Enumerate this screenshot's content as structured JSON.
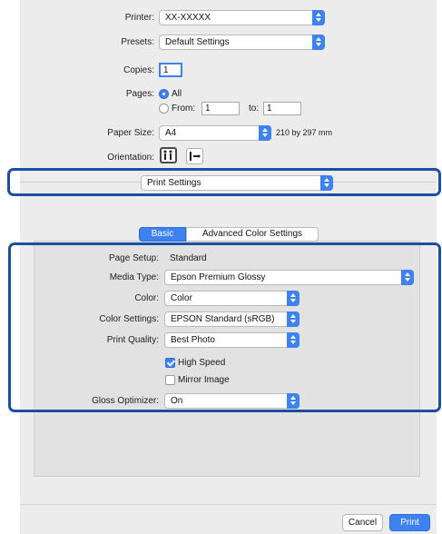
{
  "header": {
    "printer_label": "Printer:",
    "printer_value": "XX-XXXXX",
    "presets_label": "Presets:",
    "presets_value": "Default Settings",
    "copies_label": "Copies:",
    "copies_value": "1",
    "pages_label": "Pages:",
    "pages_all": "All",
    "pages_from": "From:",
    "pages_from_value": "1",
    "pages_to": "to:",
    "pages_to_value": "1",
    "paper_size_label": "Paper Size:",
    "paper_size_value": "A4",
    "paper_size_dims": "210 by 297 mm",
    "orientation_label": "Orientation:"
  },
  "section_menu": {
    "value": "Print Settings"
  },
  "tabs": [
    {
      "label": "Basic",
      "active": true
    },
    {
      "label": "Advanced Color Settings",
      "active": false
    }
  ],
  "basic": {
    "page_setup_label": "Page Setup:",
    "page_setup_value": "Standard",
    "media_type_label": "Media Type:",
    "media_type_value": "Epson Premium Glossy",
    "color_label": "Color:",
    "color_value": "Color",
    "color_settings_label": "Color Settings:",
    "color_settings_value": "EPSON Standard (sRGB)",
    "print_quality_label": "Print Quality:",
    "print_quality_value": "Best Photo",
    "high_speed_label": "High Speed",
    "high_speed_checked": true,
    "mirror_image_label": "Mirror Image",
    "mirror_image_checked": false,
    "gloss_optimizer_label": "Gloss Optimizer:",
    "gloss_optimizer_value": "On"
  },
  "footer": {
    "cancel_label": "Cancel",
    "print_label": "Print"
  },
  "colors": {
    "accent": "#3d82f0",
    "highlight_frame": "#1d4fa0",
    "dialog_bg": "#ececec"
  }
}
